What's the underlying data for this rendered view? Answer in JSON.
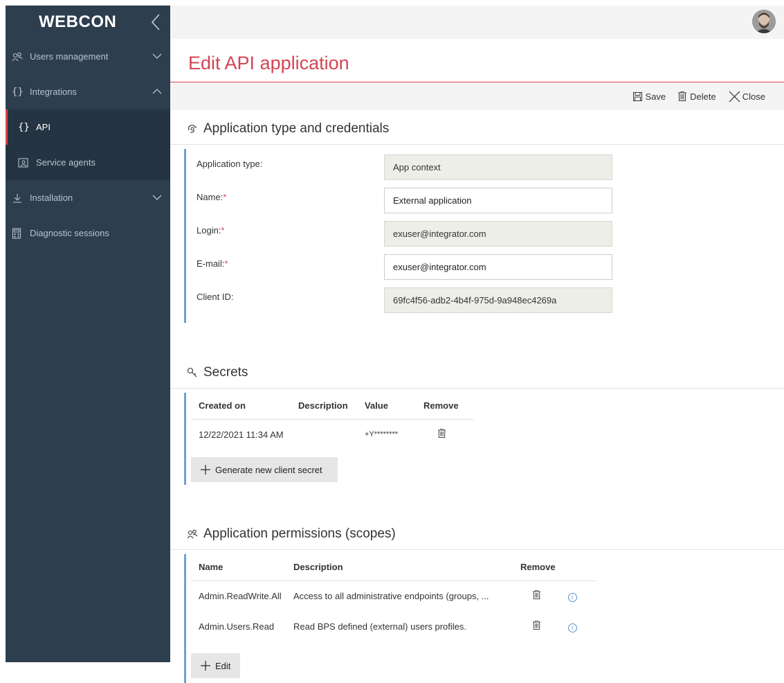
{
  "sidebar": {
    "logo": "WEBCON",
    "items": [
      {
        "label": "Users management",
        "icon": "users-icon"
      },
      {
        "label": "Integrations",
        "icon": "braces-icon"
      },
      {
        "label": "API",
        "icon": "braces-icon"
      },
      {
        "label": "Service agents",
        "icon": "service-agent-icon"
      },
      {
        "label": "Installation",
        "icon": "download-icon"
      },
      {
        "label": "Diagnostic sessions",
        "icon": "calculator-icon"
      }
    ]
  },
  "header": {
    "title": "Edit API application"
  },
  "toolbar": {
    "save_label": "Save",
    "delete_label": "Delete",
    "close_label": "Close"
  },
  "credentials": {
    "section_title": "Application type and credentials",
    "fields": [
      {
        "label": "Application type:",
        "value": "App context",
        "required": false,
        "readonly": true
      },
      {
        "label": "Name:",
        "value": "External application",
        "required": true,
        "readonly": false
      },
      {
        "label": "Login:",
        "value": "exuser@integrator.com",
        "required": true,
        "readonly": true
      },
      {
        "label": "E-mail:",
        "value": "exuser@integrator.com",
        "required": true,
        "readonly": false
      },
      {
        "label": "Client ID:",
        "value": "69fc4f56-adb2-4b4f-975d-9a948ec4269a",
        "required": false,
        "readonly": true
      }
    ]
  },
  "secrets": {
    "section_title": "Secrets",
    "columns": [
      "Created on",
      "Description",
      "Value",
      "Remove"
    ],
    "rows": [
      {
        "created_on": "12/22/2021 11:34 AM",
        "description": "",
        "value": "+Y********"
      }
    ],
    "generate_label": "Generate new client secret"
  },
  "permissions": {
    "section_title": "Application permissions (scopes)",
    "columns": [
      "Name",
      "Description",
      "Remove"
    ],
    "rows": [
      {
        "name": "Admin.ReadWrite.All",
        "description": "Access to all administrative endpoints (groups, ..."
      },
      {
        "name": "Admin.Users.Read",
        "description": "Read BPS defined (external) users profiles."
      }
    ],
    "edit_label": "Edit"
  },
  "colors": {
    "accent": "#d44453",
    "sidebar_bg": "#2d3e4e",
    "section_border": "#6ea0d6"
  }
}
